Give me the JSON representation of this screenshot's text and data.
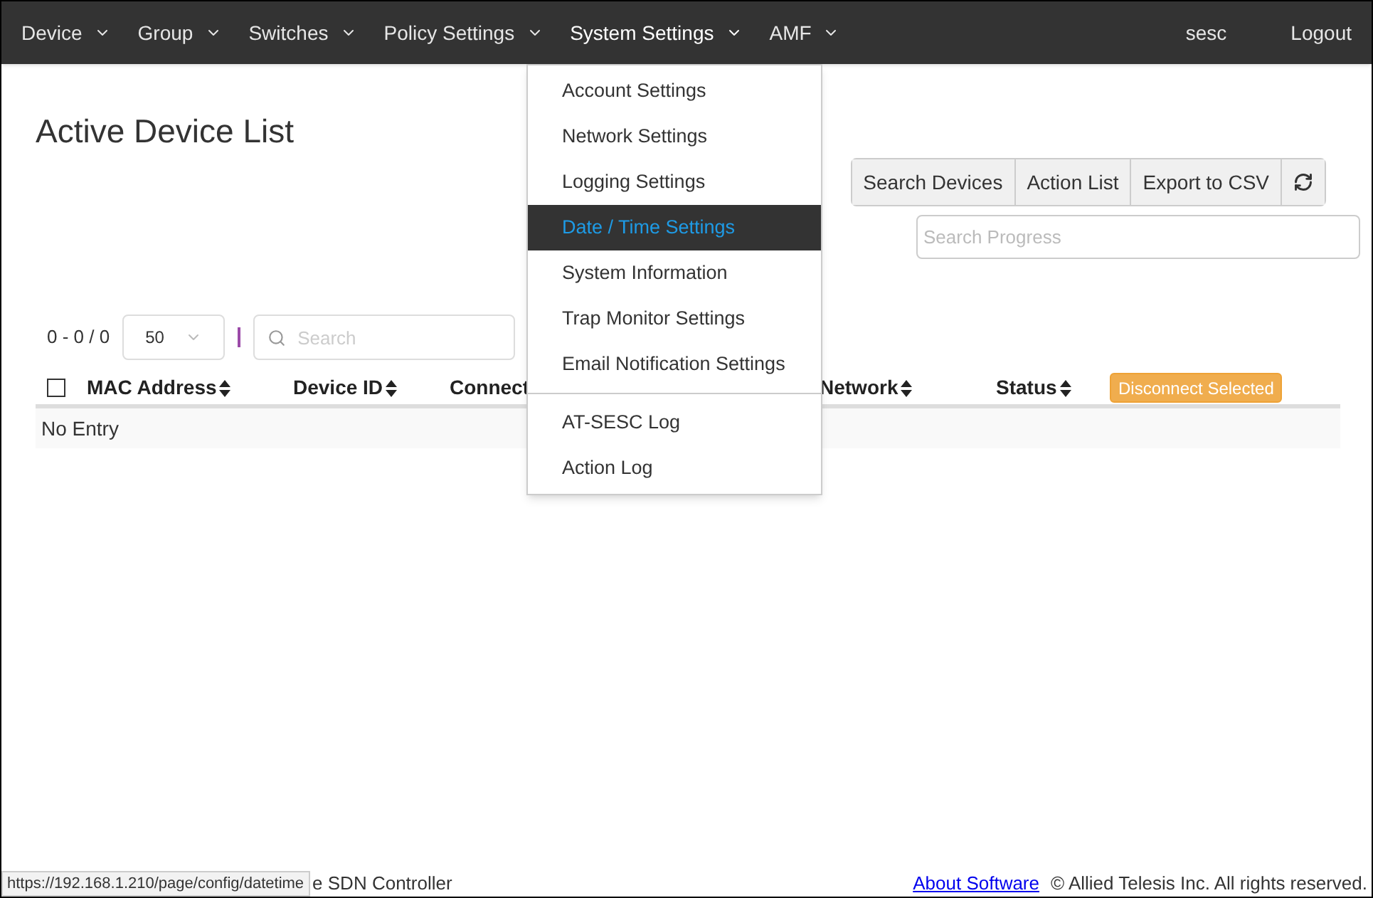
{
  "navbar": {
    "menus": [
      {
        "label": "Device",
        "open": false
      },
      {
        "label": "Group",
        "open": false
      },
      {
        "label": "Switches",
        "open": false
      },
      {
        "label": "Policy Settings",
        "open": false
      },
      {
        "label": "System Settings",
        "open": true
      },
      {
        "label": "AMF",
        "open": false
      }
    ],
    "user": "sesc",
    "logout": "Logout"
  },
  "dropdown": {
    "groups": [
      [
        {
          "label": "Account Settings",
          "selected": false
        },
        {
          "label": "Network Settings",
          "selected": false
        },
        {
          "label": "Logging Settings",
          "selected": false
        },
        {
          "label": "Date / Time Settings",
          "selected": true
        },
        {
          "label": "System Information",
          "selected": false
        },
        {
          "label": "Trap Monitor Settings",
          "selected": false
        },
        {
          "label": "Email Notification Settings",
          "selected": false
        }
      ],
      [
        {
          "label": "AT-SESC Log",
          "selected": false
        },
        {
          "label": "Action Log",
          "selected": false
        }
      ]
    ]
  },
  "page_title": "Active Device List",
  "toolbar": {
    "buttons": [
      "Search Devices",
      "Action List",
      "Export to CSV"
    ],
    "progress_placeholder": "Search Progress"
  },
  "table_controls": {
    "range": "0 - 0 / 0",
    "page_size": "50",
    "search_placeholder": "Search"
  },
  "table": {
    "select_all_checked": false,
    "columns": [
      "MAC Address",
      "Device ID",
      "Connect",
      "Network",
      "Status"
    ],
    "action_button": "Disconnect Selected",
    "empty_text": "No Entry"
  },
  "footer": {
    "status_url": "https://192.168.1.210/page/config/datetime",
    "left_text": "e SDN Controller",
    "link": "About Software",
    "copyright": "© Allied Telesis Inc. All rights reserved."
  }
}
